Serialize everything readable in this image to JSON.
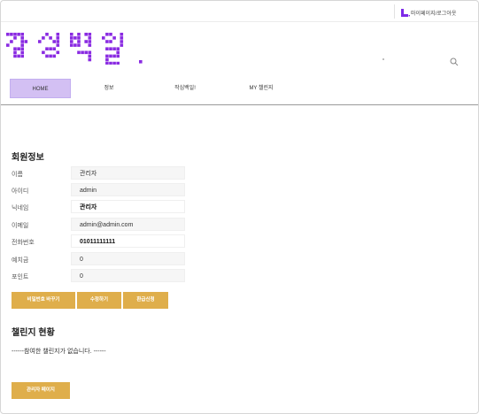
{
  "header": {
    "links": [
      "마이페이지",
      "/",
      "로그아웃"
    ],
    "brand_color": "#8a2be2",
    "logo_alt": "작심백일."
  },
  "nav": {
    "items": [
      {
        "label": "HOME",
        "active": true
      },
      {
        "label": "정보",
        "active": false
      },
      {
        "label": "작심백일!",
        "active": false
      },
      {
        "label": "MY 챌린지",
        "active": false
      }
    ],
    "active_color": "#d3c0f3"
  },
  "member": {
    "title": "회원정보",
    "fields": [
      {
        "label": "이름",
        "value": "관리자",
        "editable": false
      },
      {
        "label": "아이디",
        "value": "admin",
        "editable": false
      },
      {
        "label": "닉네임",
        "value": "관리자",
        "editable": true
      },
      {
        "label": "이메일",
        "value": "admin@admin.com",
        "editable": false
      },
      {
        "label": "전화번호",
        "value": "01011111111",
        "editable": true
      },
      {
        "label": "예치금",
        "value": "0",
        "editable": false
      },
      {
        "label": "포인트",
        "value": "0",
        "editable": false
      }
    ],
    "buttons": {
      "change_password": "비밀번호 바꾸기",
      "edit": "수정하기",
      "refund": "환급신청"
    }
  },
  "challenge": {
    "title": "챌린지 현황",
    "empty_message": "------참여한 챌린지가 없습니다. ------"
  },
  "admin": {
    "button": "관리자 페이지"
  },
  "colors": {
    "button": "#dfae4b"
  }
}
